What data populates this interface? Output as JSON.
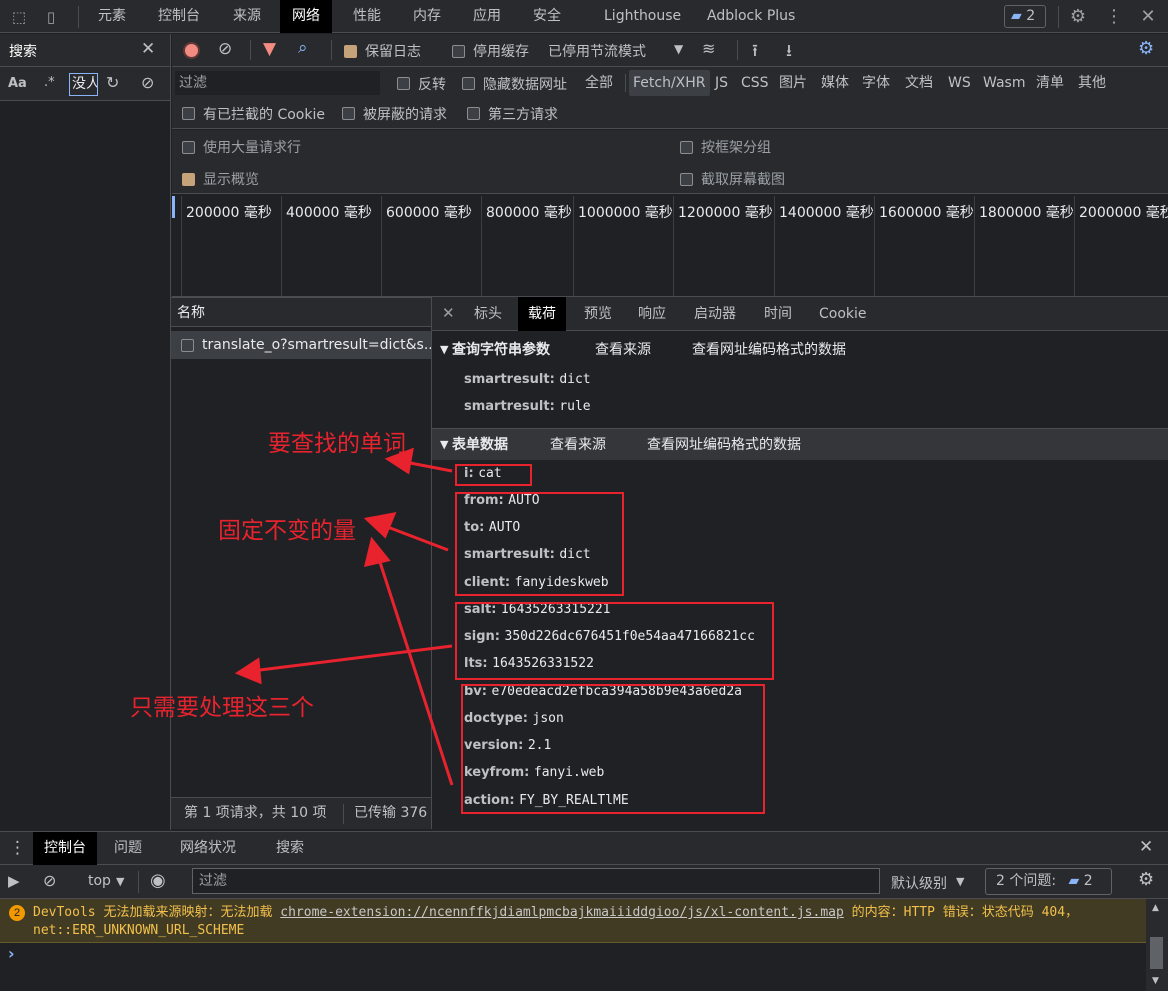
{
  "topbar": {
    "tabs": [
      "元素",
      "控制台",
      "来源",
      "网络",
      "性能",
      "内存",
      "应用",
      "安全",
      "Lighthouse",
      "Adblock Plus"
    ],
    "issues_count": "2"
  },
  "search_panel": {
    "title": "搜索",
    "aa": "Aa",
    "regex": ".*",
    "input_value": "没人"
  },
  "toolbar": {
    "preserve_log": "保留日志",
    "disable_cache": "停用缓存",
    "throttling": "已停用节流模式"
  },
  "filter": {
    "placeholder": "过滤",
    "invert": "反转",
    "hide_data_urls": "隐藏数据网址",
    "types": [
      "全部",
      "Fetch/XHR",
      "JS",
      "CSS",
      "图片",
      "媒体",
      "字体",
      "文档",
      "WS",
      "Wasm",
      "清单",
      "其他"
    ],
    "selected_type": "Fetch/XHR",
    "blocked_cookies": "有已拦截的 Cookie",
    "blocked_requests": "被屏蔽的请求",
    "third_party": "第三方请求"
  },
  "settings": {
    "large_rows": "使用大量请求行",
    "group_by_frame": "按框架分组",
    "show_overview": "显示概览",
    "capture_screenshots": "截取屏幕截图"
  },
  "timeline": {
    "ticks": [
      "200000 毫秒",
      "400000 毫秒",
      "600000 毫秒",
      "800000 毫秒",
      "1000000 毫秒",
      "1200000 毫秒",
      "1400000 毫秒",
      "1600000 毫秒",
      "1800000 毫秒",
      "2000000 毫秒"
    ]
  },
  "requests": {
    "column_name": "名称",
    "items": [
      "translate_o?smartresult=dict&s..."
    ],
    "status": "第 1 项请求，共 10 项",
    "transferred": "已传输 376"
  },
  "detail": {
    "tabs": [
      "标头",
      "载荷",
      "预览",
      "响应",
      "启动器",
      "时间",
      "Cookie"
    ],
    "active_tab": "载荷",
    "query_section": {
      "title": "查询字符串参数",
      "view_source": "查看来源",
      "view_encoded": "查看网址编码格式的数据",
      "params": [
        {
          "k": "smartresult",
          "v": "dict"
        },
        {
          "k": "smartresult",
          "v": "rule"
        }
      ]
    },
    "form_section": {
      "title": "表单数据",
      "view_source": "查看来源",
      "view_encoded": "查看网址编码格式的数据",
      "params": [
        {
          "k": "i",
          "v": "cat"
        },
        {
          "k": "from",
          "v": "AUTO"
        },
        {
          "k": "to",
          "v": "AUTO"
        },
        {
          "k": "smartresult",
          "v": "dict"
        },
        {
          "k": "client",
          "v": "fanyideskweb"
        },
        {
          "k": "salt",
          "v": "16435263315221"
        },
        {
          "k": "sign",
          "v": "350d226dc676451f0e54aa47166821cc"
        },
        {
          "k": "lts",
          "v": "1643526331522"
        },
        {
          "k": "bv",
          "v": "e70edeacd2efbca394a58b9e43a6ed2a"
        },
        {
          "k": "doctype",
          "v": "json"
        },
        {
          "k": "version",
          "v": "2.1"
        },
        {
          "k": "keyfrom",
          "v": "fanyi.web"
        },
        {
          "k": "action",
          "v": "FY_BY_REALTlME"
        }
      ]
    }
  },
  "annotations": {
    "word": "要查找的单词",
    "fixed": "固定不变的量",
    "three": "只需要处理这三个"
  },
  "drawer": {
    "tabs": [
      "控制台",
      "问题",
      "网络状况",
      "搜索"
    ],
    "context": "top",
    "filter_placeholder": "过滤",
    "level": "默认级别",
    "issues": "2 个问题:",
    "issues_count": "2"
  },
  "console": {
    "warn_count": "2",
    "warn_prefix": "DevTools 无法加载来源映射：无法加载 ",
    "warn_link": "chrome-extension://ncennffkjdiamlpmcbajkmaiiiddgioo/js/xl-content.js.map",
    "warn_suffix": " 的内容：HTTP 错误：状态代码 404，net::ERR_UNKNOWN_URL_SCHEME",
    "prompt": "›"
  },
  "colors": {
    "annotation": "#e8232e",
    "accent": "#8ab4f8",
    "record": "#f28b82"
  }
}
